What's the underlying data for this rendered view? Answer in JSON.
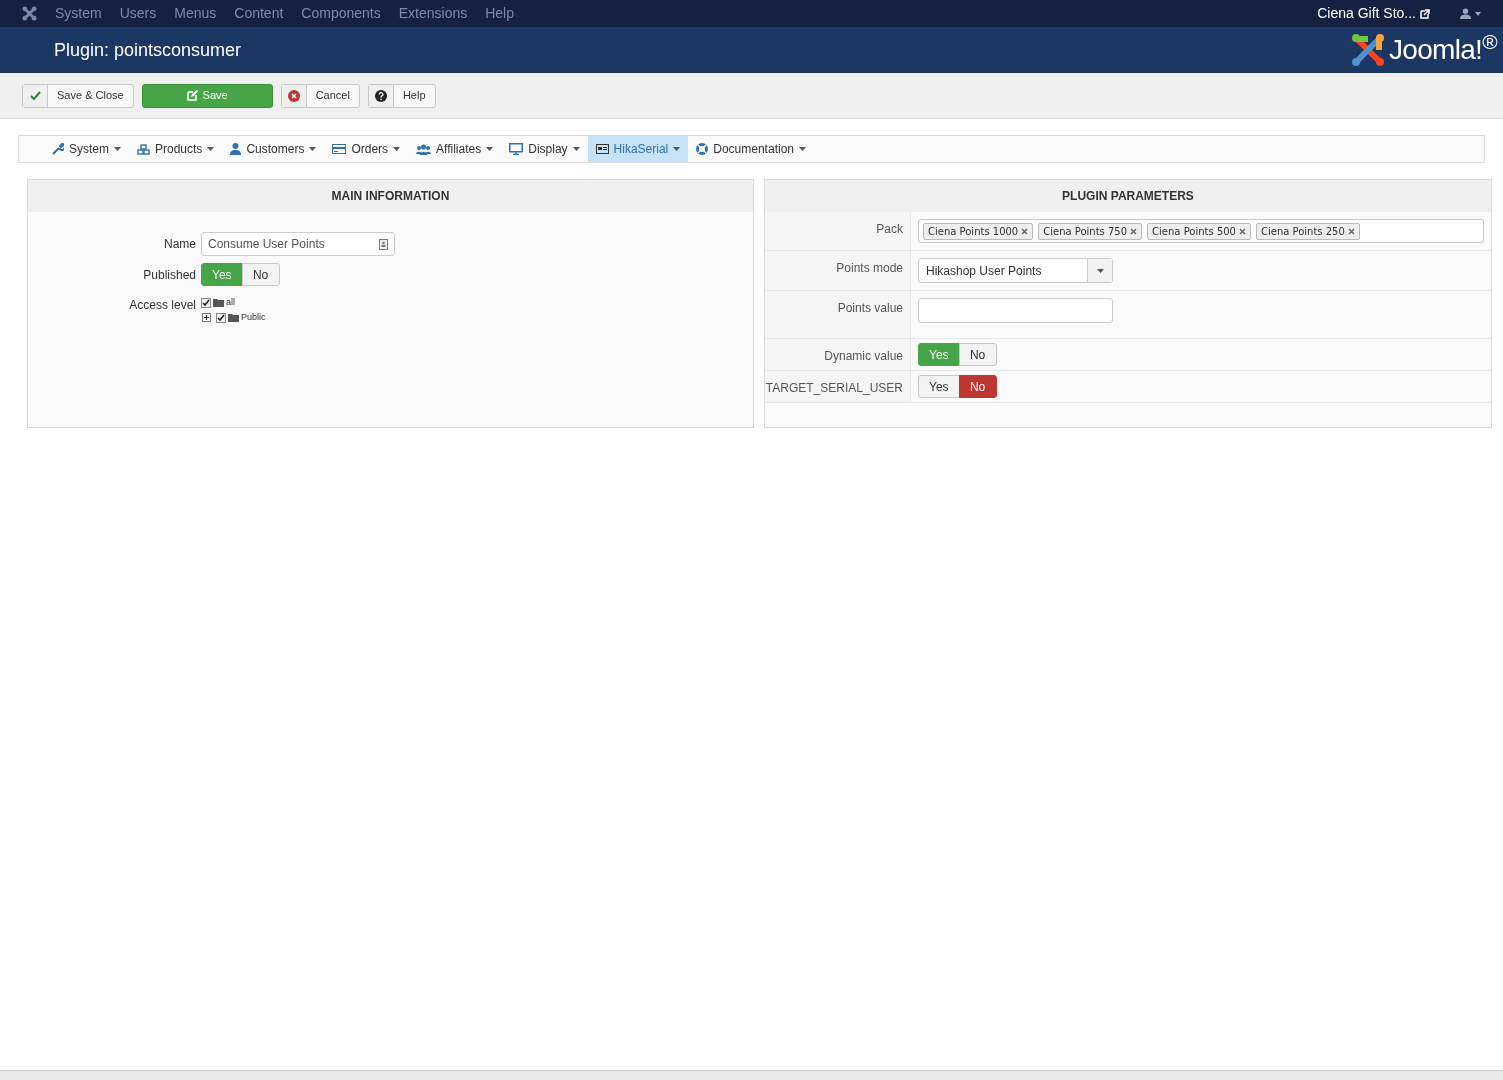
{
  "top_menu": {
    "items": [
      "System",
      "Users",
      "Menus",
      "Content",
      "Components",
      "Extensions",
      "Help"
    ],
    "site_link": "Ciena Gift Sto..."
  },
  "header": {
    "title": "Plugin: pointsconsumer",
    "logo": "Joomla!$^{®}$"
  },
  "toolbar": [
    {
      "label": "Save & Close",
      "kind": "default"
    },
    {
      "label": "Save",
      "kind": "primary"
    },
    {
      "label": "Cancel",
      "kind": "default"
    },
    {
      "label": "Help",
      "kind": "default"
    }
  ],
  "submenu": [
    {
      "label": "System",
      "selected": false
    },
    {
      "label": "Products",
      "selected": false
    },
    {
      "label": "Customers",
      "selected": false
    },
    {
      "label": "Orders",
      "selected": false
    },
    {
      "label": "Affiliates",
      "selected": false
    },
    {
      "label": "Display",
      "selected": false
    },
    {
      "label": "HikaSerial",
      "selected": true
    },
    {
      "label": "Documentation",
      "selected": false
    }
  ],
  "main_information": {
    "title": "MAIN INFORMATION",
    "fields": [
      {
        "label": "Name",
        "kind": "text",
        "value": "Consume User Points"
      },
      {
        "label": "Published",
        "kind": "toggle",
        "options": [
          {
            "label": "Yes",
            "selected": true
          },
          {
            "label": "No",
            "selected": false
          }
        ]
      },
      {
        "label": "Access level",
        "kind": "tree",
        "nodes": [
          {
            "label": "all",
            "checked": true,
            "children": [
              {
                "label": "Public",
                "checked": true,
                "expanded": false
              }
            ]
          }
        ]
      }
    ]
  },
  "plugin_parameters": {
    "title": "PLUGIN PARAMETERS",
    "rows": [
      {
        "label": "Pack",
        "kind": "tags",
        "tags": [
          "Ciena Points 1000",
          "Ciena Points 750",
          "Ciena Points 500",
          "Ciena Points 250"
        ]
      },
      {
        "label": "Points mode",
        "kind": "select",
        "value": "Hikashop User Points"
      },
      {
        "label": "Points value",
        "kind": "text"
      },
      {
        "label": "Dynamic value",
        "kind": "toggle",
        "options": [
          {
            "label": "Yes",
            "selected": true
          },
          {
            "label": "No",
            "selected": false
          }
        ]
      },
      {
        "label": "TARGET_SERIAL_USER",
        "kind": "toggle",
        "options": [
          {
            "label": "Yes",
            "selected": false
          },
          {
            "label": "No",
            "selected": true
          }
        ]
      }
    ]
  }
}
